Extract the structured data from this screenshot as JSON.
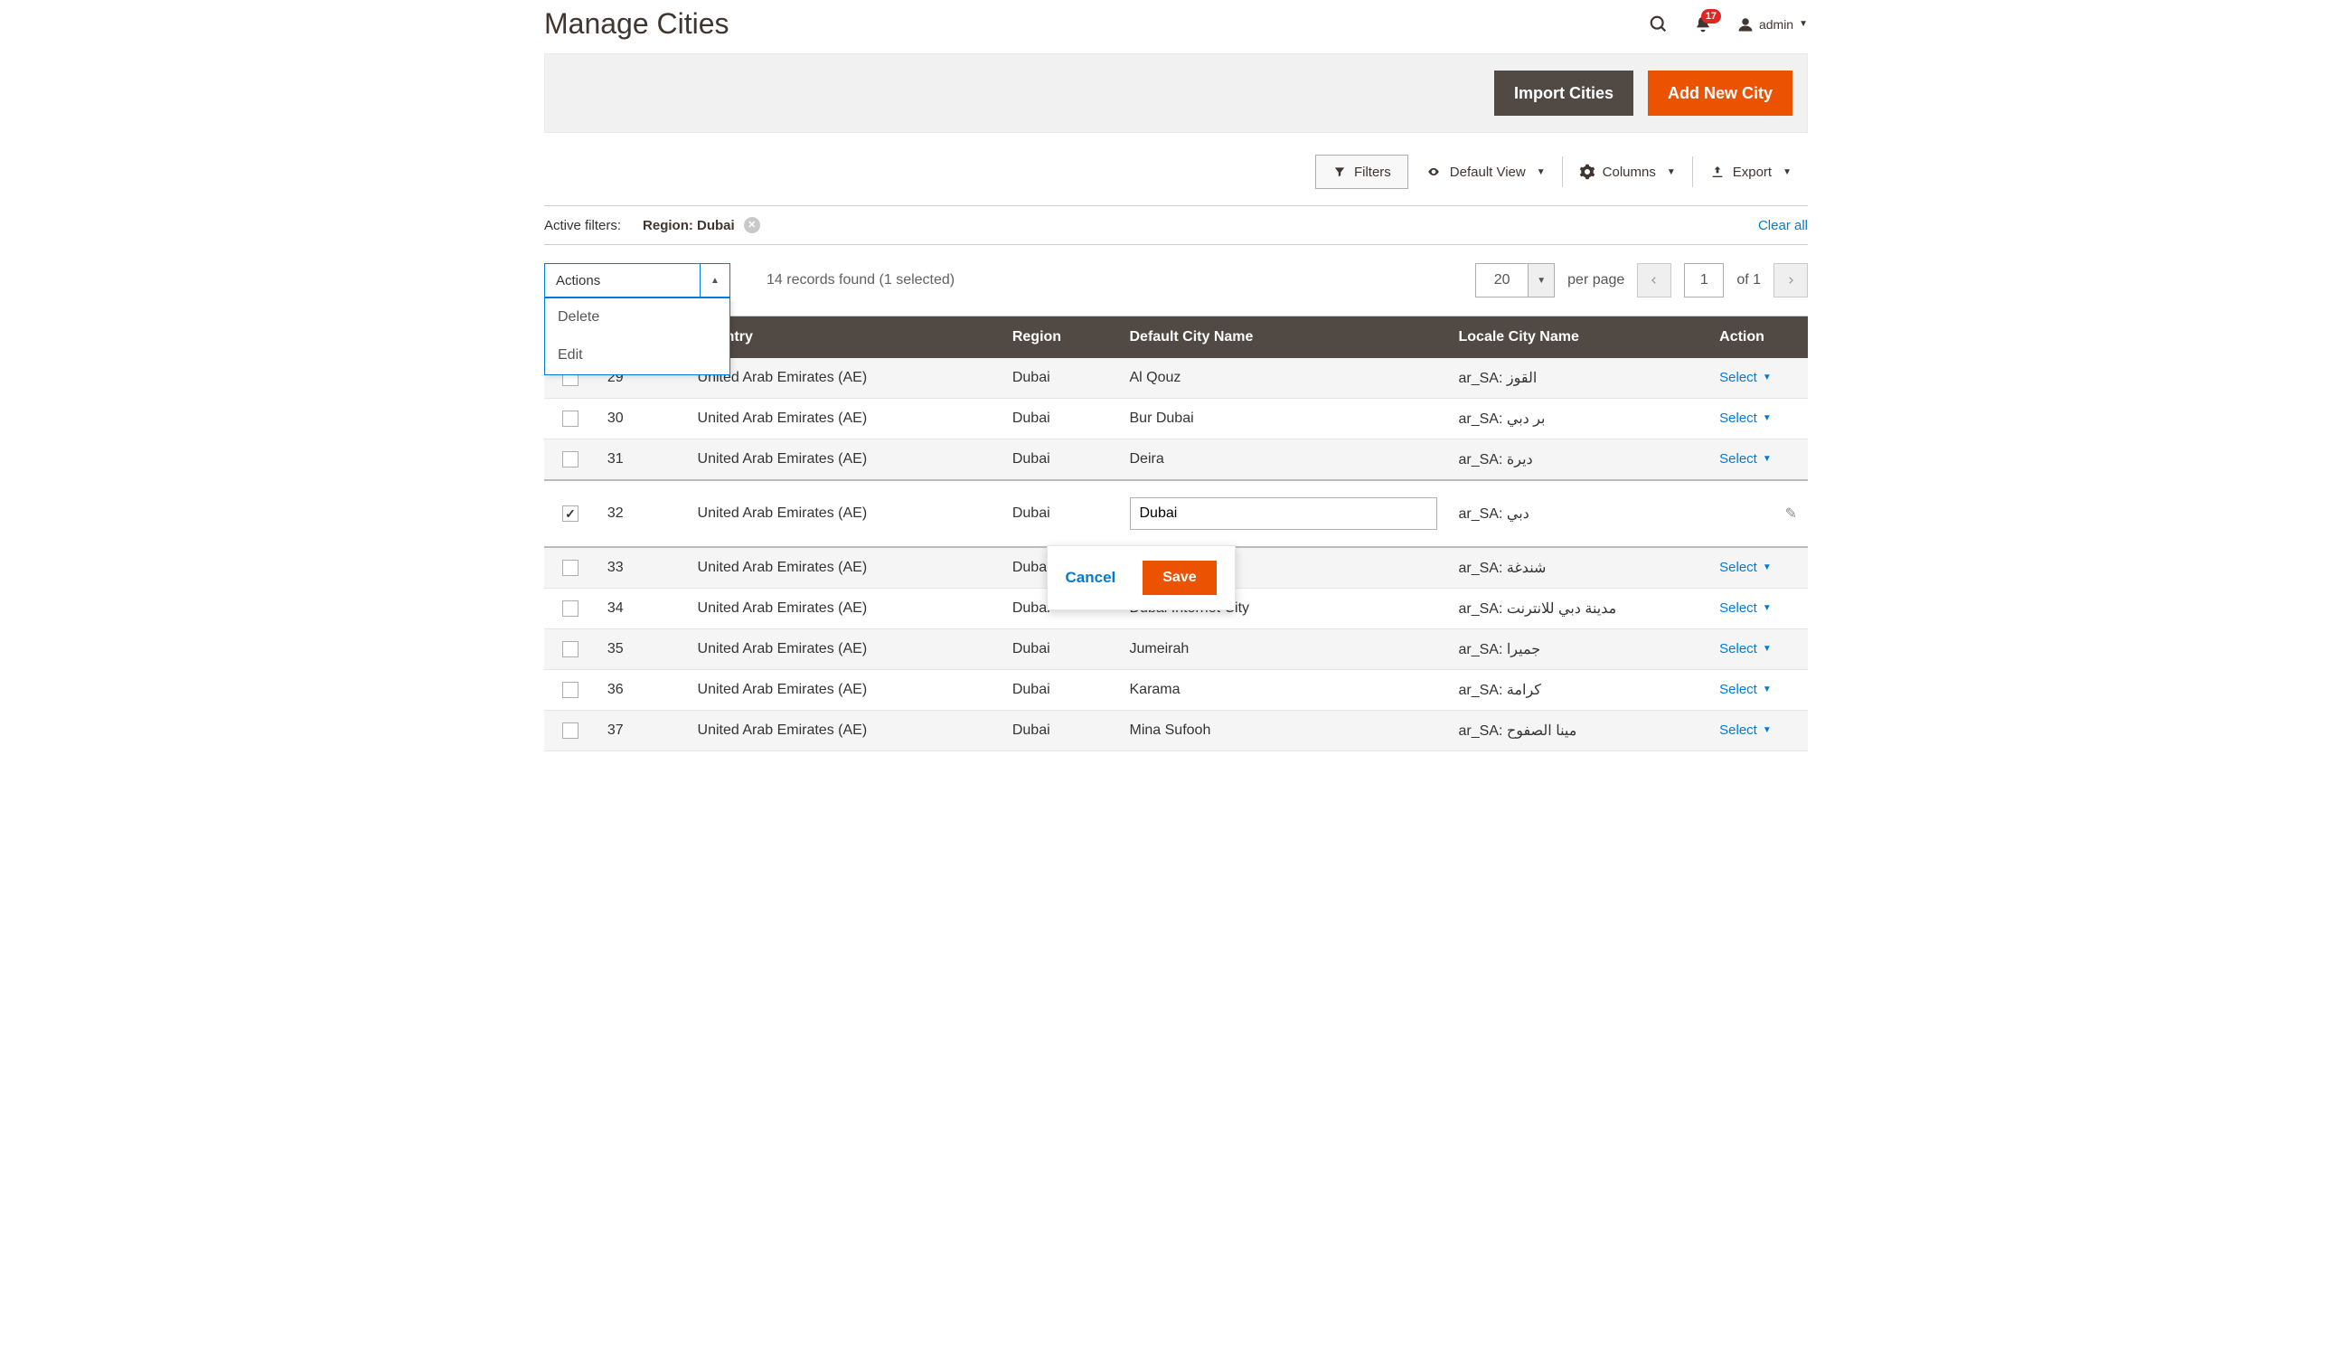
{
  "header": {
    "title": "Manage Cities",
    "notifications": "17",
    "user_label": "admin"
  },
  "actionbar": {
    "import_label": "Import Cities",
    "add_label": "Add New City"
  },
  "toolbar": {
    "filters_label": "Filters",
    "default_view_label": "Default View",
    "columns_label": "Columns",
    "export_label": "Export"
  },
  "filters_row": {
    "active_label": "Active filters:",
    "chip_label": "Region: Dubai",
    "clear_all": "Clear all"
  },
  "controls": {
    "actions_label": "Actions",
    "actions_items": [
      "Delete",
      "Edit"
    ],
    "records_found": "14 records found (1 selected)",
    "per_page_value": "20",
    "per_page_label": "per page",
    "page_current": "1",
    "page_total_label": "of 1"
  },
  "table": {
    "columns": {
      "country": "Country",
      "region": "Region",
      "name": "Default City Name",
      "locale": "Locale City Name",
      "action": "Action"
    },
    "select_label": "Select",
    "rows": [
      {
        "id": "29",
        "country": "United Arab Emirates (AE)",
        "region": "Dubai",
        "name": "Al Qouz",
        "locale": "ar_SA: القوز",
        "checked": false,
        "editing": false
      },
      {
        "id": "30",
        "country": "United Arab Emirates (AE)",
        "region": "Dubai",
        "name": "Bur Dubai",
        "locale": "ar_SA: بر دبي",
        "checked": false,
        "editing": false
      },
      {
        "id": "31",
        "country": "United Arab Emirates (AE)",
        "region": "Dubai",
        "name": "Deira",
        "locale": "ar_SA: ديرة",
        "checked": false,
        "editing": false
      },
      {
        "id": "32",
        "country": "United Arab Emirates (AE)",
        "region": "Dubai",
        "name": "Dubai",
        "locale": "ar_SA: دبي",
        "checked": true,
        "editing": true
      },
      {
        "id": "33",
        "country": "United Arab Emirates (AE)",
        "region": "Dubai",
        "name": "",
        "locale": "ar_SA: شندغة",
        "checked": false,
        "editing": false
      },
      {
        "id": "34",
        "country": "United Arab Emirates (AE)",
        "region": "Dubai",
        "name": "Dubai Internet City",
        "locale": "ar_SA: مدينة دبي للانترنت",
        "checked": false,
        "editing": false
      },
      {
        "id": "35",
        "country": "United Arab Emirates (AE)",
        "region": "Dubai",
        "name": "Jumeirah",
        "locale": "ar_SA: جميرا",
        "checked": false,
        "editing": false
      },
      {
        "id": "36",
        "country": "United Arab Emirates (AE)",
        "region": "Dubai",
        "name": "Karama",
        "locale": "ar_SA: كرامة",
        "checked": false,
        "editing": false
      },
      {
        "id": "37",
        "country": "United Arab Emirates (AE)",
        "region": "Dubai",
        "name": "Mina Sufooh",
        "locale": "ar_SA: مينا الصفوح",
        "checked": false,
        "editing": false
      }
    ]
  },
  "edit_popup": {
    "cancel": "Cancel",
    "save": "Save"
  }
}
